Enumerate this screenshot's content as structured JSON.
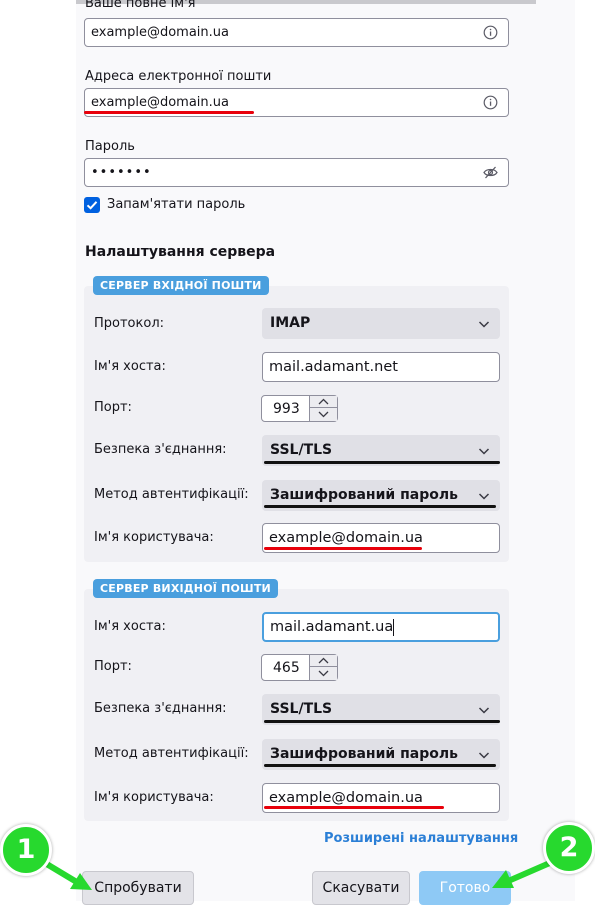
{
  "account": {
    "full_name_label": "Ваше повне ім'я",
    "full_name_value": "example@domain.ua",
    "email_label": "Адреса електронної пошти",
    "email_value": "example@domain.ua",
    "password_label": "Пароль",
    "password_value": "•••••••",
    "remember_label": "Запам'ятати пароль",
    "remember_checked": true
  },
  "server_settings": {
    "title": "Налаштування сервера",
    "incoming": {
      "badge": "СЕРВЕР ВХІДНОЇ ПОШТИ",
      "protocol_label": "Протокол:",
      "protocol_value": "IMAP",
      "host_label": "Ім'я хоста:",
      "host_value": "mail.adamant.net",
      "port_label": "Порт:",
      "port_value": "993",
      "security_label": "Безпека з'єднання:",
      "security_value": "SSL/TLS",
      "auth_label": "Метод автентифікації:",
      "auth_value": "Зашифрований пароль",
      "username_label": "Ім'я користувача:",
      "username_value": "example@domain.ua"
    },
    "outgoing": {
      "badge": "СЕРВЕР ВИХІДНОЇ ПОШТИ",
      "host_label": "Ім'я хоста:",
      "host_value": "mail.adamant.ua",
      "port_label": "Порт:",
      "port_value": "465",
      "security_label": "Безпека з'єднання:",
      "security_value": "SSL/TLS",
      "auth_label": "Метод автентифікації:",
      "auth_value": "Зашифрований пароль",
      "username_label": "Ім'я користувача:",
      "username_value": "example@domain.ua"
    },
    "advanced_link": "Розширені налаштування"
  },
  "buttons": {
    "test": "Спробувати",
    "cancel": "Скасувати",
    "done": "Готово"
  },
  "markers": {
    "one": "1",
    "two": "2"
  },
  "colors": {
    "accent": "#0061e0",
    "badge": "#4a9fde",
    "link": "#2b7fd6",
    "red_underline": "#e8000b",
    "marker_green": "#27d92e"
  }
}
